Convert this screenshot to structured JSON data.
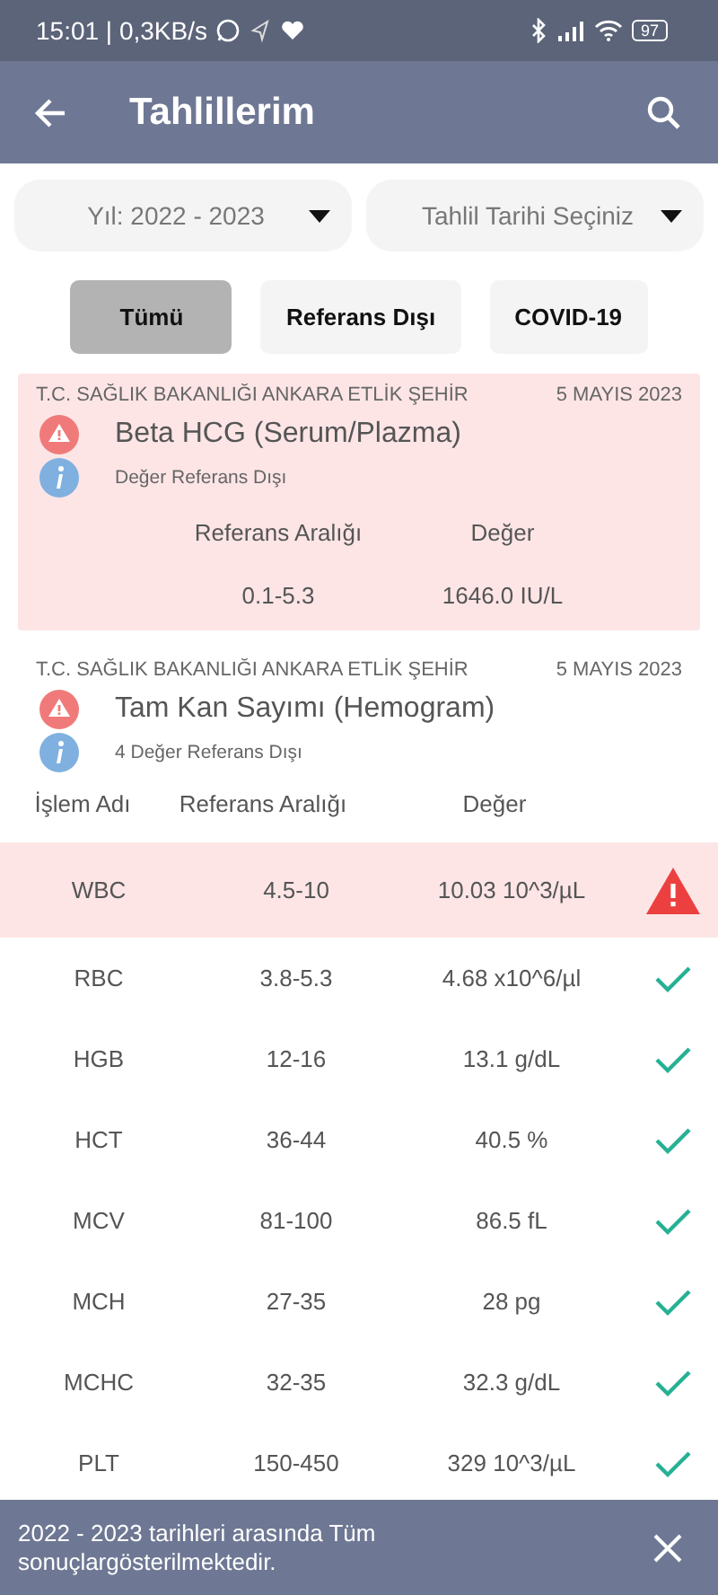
{
  "status_bar": {
    "time": "15:01 | 0,3KB/s",
    "battery": "97"
  },
  "header": {
    "title": "Tahlillerim"
  },
  "dropdowns": [
    {
      "value": "Yıl: 2022 - 2023"
    },
    {
      "value": "Tahlil Tarihi Seçiniz"
    }
  ],
  "filters": [
    {
      "label": "Tümü",
      "selected": true
    },
    {
      "label": "Referans Dışı",
      "selected": false
    },
    {
      "label": "COVID-19",
      "selected": false
    }
  ],
  "results": [
    {
      "institution": "T.C. SAĞLIK BAKANLIĞI ANKARA ETLİK ŞEHİR",
      "date": "5 MAYIS 2023",
      "test": "Beta HCG (Serum/Plazma)",
      "note": "Değer Referans Dışı",
      "out_of_range": true,
      "columns": [
        "Referans Aralığı",
        "Değer"
      ],
      "rows": [
        {
          "range": "0.1-5.3",
          "value": "1646.0 IU/L"
        }
      ]
    },
    {
      "institution": "T.C. SAĞLIK BAKANLIĞI ANKARA ETLİK ŞEHİR",
      "date": "5 MAYIS 2023",
      "test": "Tam Kan Sayımı (Hemogram)",
      "note": "4 Değer Referans Dışı",
      "out_of_range": false,
      "columns": [
        "İşlem Adı",
        "Referans Aralığı",
        "Değer"
      ],
      "rows": [
        {
          "name": "WBC",
          "range": "4.5-10",
          "value": "10.03 10^3/µL",
          "out_of_range": true
        },
        {
          "name": "RBC",
          "range": "3.8-5.3",
          "value": "4.68 x10^6/µl",
          "out_of_range": false
        },
        {
          "name": "HGB",
          "range": "12-16",
          "value": "13.1 g/dL",
          "out_of_range": false
        },
        {
          "name": "HCT",
          "range": "36-44",
          "value": "40.5 %",
          "out_of_range": false
        },
        {
          "name": "MCV",
          "range": "81-100",
          "value": "86.5 fL",
          "out_of_range": false
        },
        {
          "name": "MCH",
          "range": "27-35",
          "value": "28 pg",
          "out_of_range": false
        },
        {
          "name": "MCHC",
          "range": "32-35",
          "value": "32.3 g/dL",
          "out_of_range": false
        },
        {
          "name": "PLT",
          "range": "150-450",
          "value": "329 10^3/µL",
          "out_of_range": false
        }
      ]
    }
  ],
  "snackbar": {
    "message": "2022 - 2023 tarihleri arasında Tüm sonuçlargösterilmektedir."
  }
}
